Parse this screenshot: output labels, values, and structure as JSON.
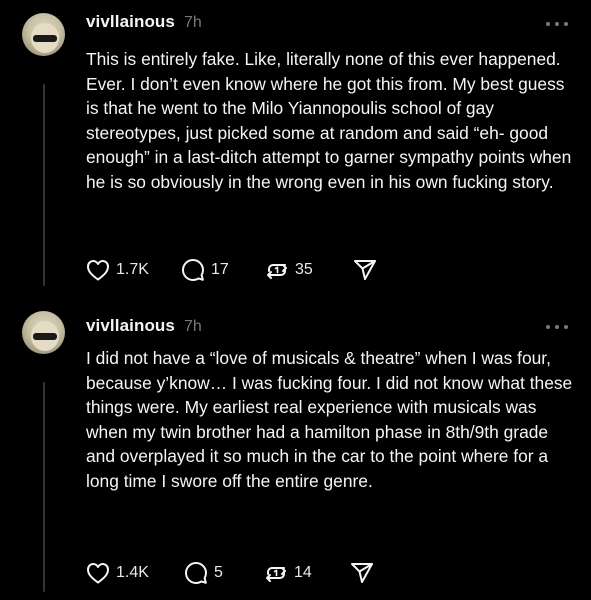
{
  "posts": [
    {
      "username": "vivllainous",
      "timestamp": "7h",
      "body": "This is entirely fake. Like, literally none of this ever happened. Ever. I don’t even know where he got this from. My best guess is that he went to the Milo Yiannopoulis school of gay stereotypes, just picked some at random and said “eh- good enough” in a last-ditch attempt to garner sympathy points when he is so obviously in the wrong even in his own fucking story.",
      "likes": "1.7K",
      "replies": "17",
      "reposts": "35"
    },
    {
      "username": "vivllainous",
      "timestamp": "7h",
      "body": "I did not have a “love of musicals & theatre” when I was four, because y’know… I was fucking four. I did not know what these things were. My earliest real experience with musicals was when my twin brother had a hamilton phase in 8th/9th grade and overplayed it so much in the car to the point where for a long time I swore off the entire genre.",
      "likes": "1.4K",
      "replies": "5",
      "reposts": "14"
    }
  ],
  "icons": {
    "like": "heart-icon",
    "reply": "speech-bubble-icon",
    "repost": "repost-arrows-icon",
    "share": "send-icon",
    "more": "more-dots-icon"
  },
  "colors": {
    "background": "#000000",
    "text": "#f3f5f7",
    "secondary": "#777777"
  }
}
